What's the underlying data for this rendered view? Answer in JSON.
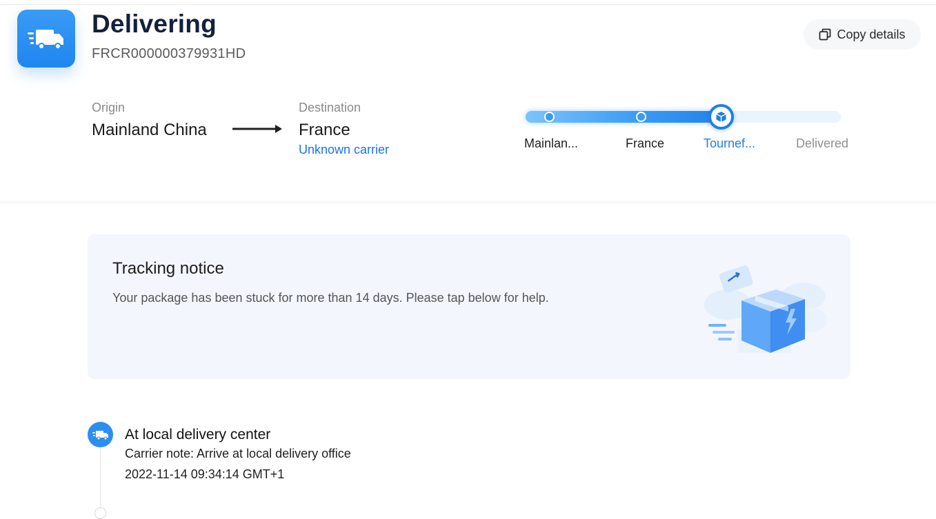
{
  "header": {
    "status": "Delivering",
    "tracking_number": "FRCR000000379931HD",
    "copy_button_label": "Copy details",
    "status_icon": "truck-icon",
    "accent_color": "#2c8ef0"
  },
  "route": {
    "origin_label": "Origin",
    "origin_value": "Mainland China",
    "destination_label": "Destination",
    "destination_value": "France",
    "carrier_link": "Unknown carrier"
  },
  "progress": {
    "stages": [
      {
        "label": "Mainlan...",
        "state": "done"
      },
      {
        "label": "France",
        "state": "done"
      },
      {
        "label": "Tournef...",
        "state": "current"
      },
      {
        "label": "Delivered",
        "state": "pending"
      }
    ],
    "active_color": "#1f7fe6",
    "pending_color": "#8f8f8f"
  },
  "notice": {
    "title": "Tracking notice",
    "text": "Your package has been stuck for more than 14 days. Please tap below for help.",
    "illustration": "package-box-illustration"
  },
  "timeline": {
    "events": [
      {
        "title": "At local delivery center",
        "note": "Carrier note: Arrive at local delivery office",
        "time": "2022-11-14 09:34:14 GMT+1",
        "icon": "truck-icon"
      }
    ]
  }
}
